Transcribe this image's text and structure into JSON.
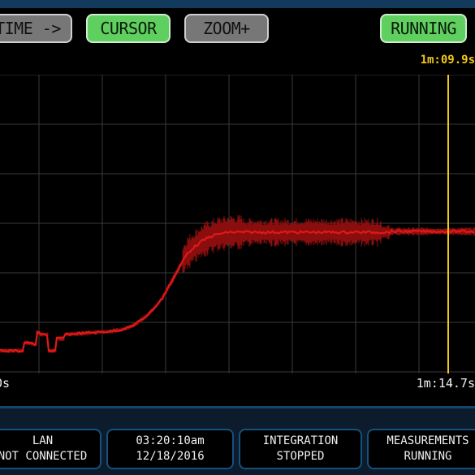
{
  "toolbar": {
    "time_label": "TIME ->",
    "cursor_label": "CURSOR",
    "zoom_label": "ZOOM+",
    "status_label": "RUNNING"
  },
  "plot": {
    "cursor_time": "1m:09.9s",
    "start_time": "0s",
    "end_time": "1m:14.7s"
  },
  "status": {
    "lan_title": "LAN",
    "lan_value": "NOT CONNECTED",
    "time": "03:20:10am",
    "date": "12/18/2016",
    "integration_title": "INTEGRATION",
    "integration_value": "STOPPED",
    "measurements_title": "MEASUREMENTS",
    "measurements_value": "RUNNING"
  },
  "colors": {
    "trace": "#e01818",
    "trace_noise": "#8a0e0e",
    "cursor": "#f2c81c",
    "grid": "#3a3a3a",
    "button_green": "#5fcf5f",
    "button_gray": "#777777"
  }
}
